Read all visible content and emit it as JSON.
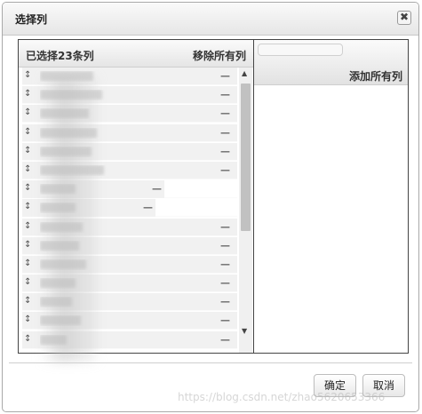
{
  "dialog": {
    "title": "选择列",
    "close_glyph": "✖"
  },
  "left_panel": {
    "header_left": "已选择23条列",
    "header_right": "移除所有列",
    "items": [
      {
        "handle": "↕",
        "remove": "—"
      },
      {
        "handle": "↕",
        "remove": "—"
      },
      {
        "handle": "↕",
        "remove": "—"
      },
      {
        "handle": "↕",
        "remove": "—"
      },
      {
        "handle": "↕",
        "remove": "—"
      },
      {
        "handle": "↕",
        "remove": "—"
      },
      {
        "handle": "↕",
        "remove": "—"
      },
      {
        "handle": "↕",
        "remove": "—"
      },
      {
        "handle": "↕",
        "remove": "—"
      },
      {
        "handle": "↕",
        "remove": "—"
      },
      {
        "handle": "↕",
        "remove": "—"
      },
      {
        "handle": "↕",
        "remove": "—"
      },
      {
        "handle": "↕",
        "remove": "—"
      },
      {
        "handle": "↕",
        "remove": "—"
      },
      {
        "handle": "↕",
        "remove": "—"
      }
    ],
    "scroll_up_glyph": "▲",
    "scroll_down_glyph": "▼"
  },
  "right_panel": {
    "search_placeholder": "",
    "add_all": "添加所有列"
  },
  "footer": {
    "ok_label": "确定",
    "cancel_label": "取消"
  },
  "watermark": "https://blog.csdn.net/zhao5620653366"
}
